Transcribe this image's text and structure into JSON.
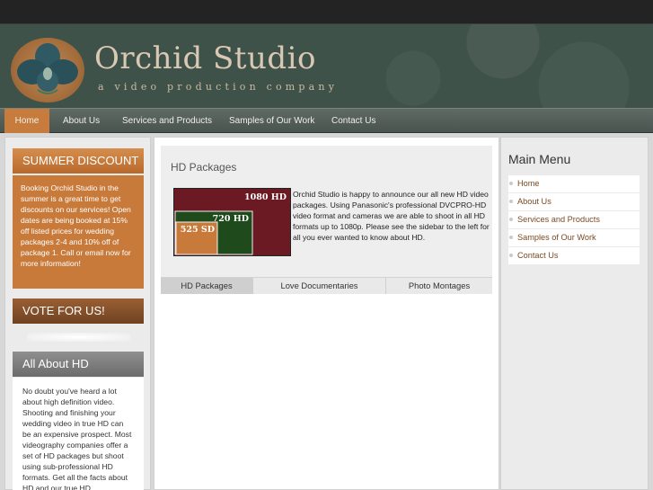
{
  "site": {
    "title": "Orchid Studio",
    "tagline": "a video production company"
  },
  "nav": {
    "items": [
      "Home",
      "About Us",
      "Services and Products",
      "Samples of Our Work",
      "Contact Us"
    ],
    "active": "Home"
  },
  "sidebar_left": {
    "discount_heading": "SUMMER DISCOUNT",
    "discount_text": "Booking Orchid Studio in the summer is a great time to get discounts on our services! Open dates are being booked at 15% off listed prices for wedding packages 2-4 and 10% off of package 1.  Call or email now for more information!",
    "vote_heading": "VOTE FOR US!",
    "about_heading": "All About HD",
    "about_text": "No doubt you've heard a lot about high definition video. Shooting and finishing your wedding video in true HD can be an expensive prospect. Most videography companies offer a set of HD packages but shoot using sub-professional HD formats.  Get all the facts about HD and our true HD"
  },
  "feature": {
    "title": "HD Packages",
    "diagram_labels": [
      "1080 HD",
      "720 HD",
      "525 SD"
    ],
    "text": "Orchid Studio is happy to announce our all new HD video packages.  Using Panasonic's professional DVCPRO-HD video format and cameras we are able to shoot in all HD formats up to 1080p.  Please see the sidebar to the left for all you ever wanted to know about HD.",
    "tabs": [
      "HD Packages",
      "Love Documentaries",
      "Photo Montages"
    ],
    "active_tab": "HD Packages"
  },
  "main_menu": {
    "title": "Main Menu",
    "items": [
      "Home",
      "About Us",
      "Services and Products",
      "Samples of Our Work",
      "Contact Us"
    ]
  },
  "colors": {
    "header_bg": "#3f5249",
    "accent_orange": "#c77b3c",
    "diagram_1080": "#6b1a23",
    "diagram_720": "#1f4a1b",
    "diagram_525": "#c87a3a",
    "menu_link": "#7a4a24"
  }
}
